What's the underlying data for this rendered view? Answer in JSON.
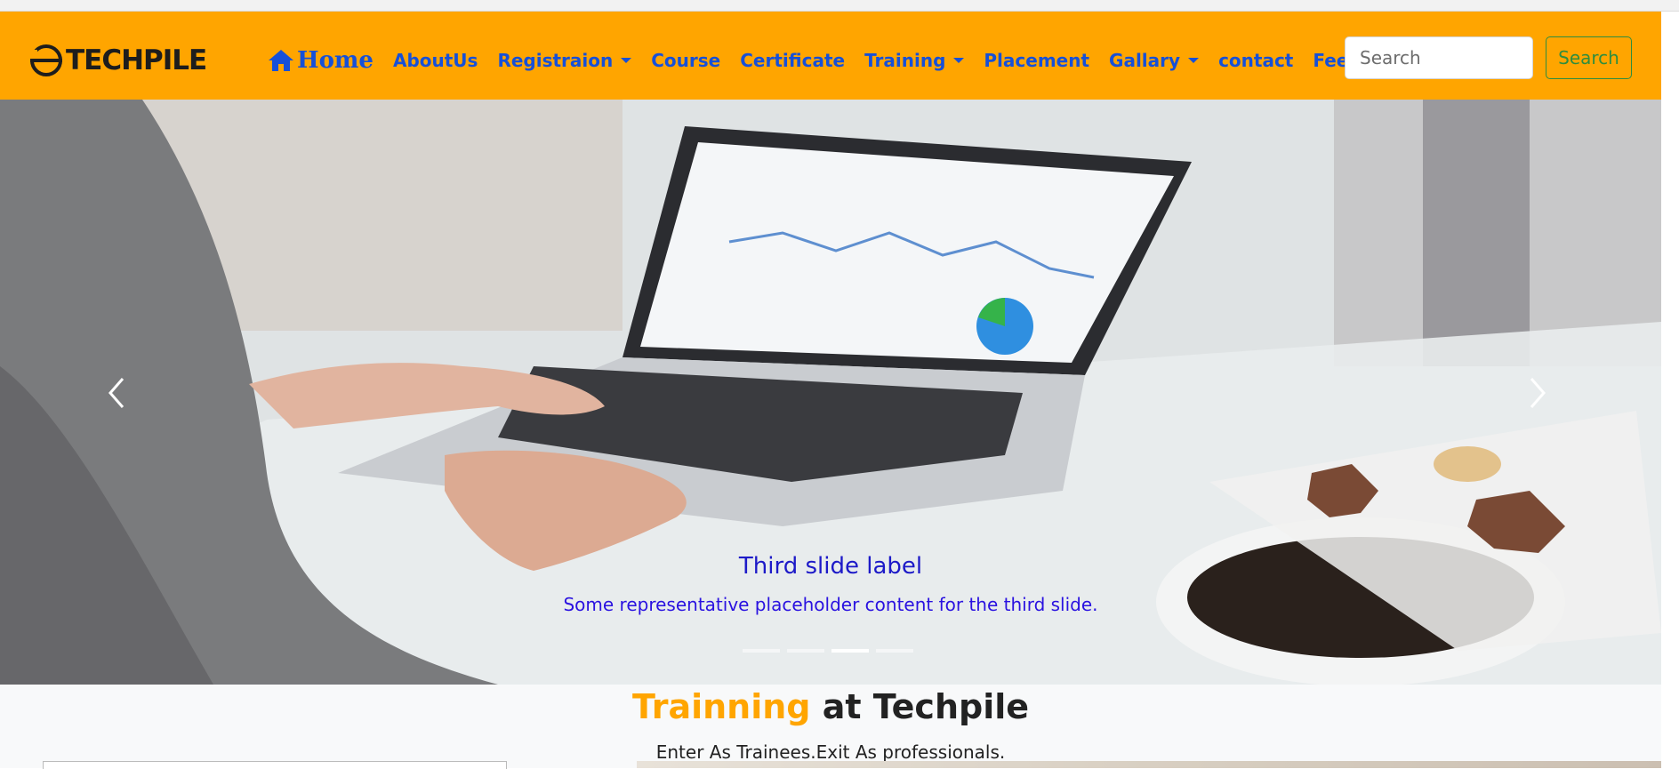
{
  "brand": {
    "name": "TECHPILE"
  },
  "nav": {
    "items": [
      {
        "label": "Home"
      },
      {
        "label": "AboutUs"
      },
      {
        "label": "Registraion"
      },
      {
        "label": "Course"
      },
      {
        "label": "Certificate"
      },
      {
        "label": "Training"
      },
      {
        "label": "Placement"
      },
      {
        "label": "Gallary"
      },
      {
        "label": "contact"
      },
      {
        "label": "Feedback"
      }
    ],
    "search_placeholder": "Search",
    "search_button": "Search"
  },
  "carousel": {
    "active_index": 2,
    "indicator_count": 4,
    "caption_title": "Third slide label",
    "caption_text": "Some representative placeholder content for the third slide."
  },
  "section": {
    "title_highlight": "Trainning",
    "title_rest": "at Techpile",
    "subtitle": "Enter As Trainees.Exit As professionals."
  },
  "colors": {
    "navbar": "#ffa500",
    "nav_link": "#1650d8",
    "search_button": "#2f8d3e",
    "caption": "#1d1ac8"
  },
  "icons": {
    "home": "home-icon",
    "prev": "chevron-left-icon",
    "next": "chevron-right-icon",
    "dropdown": "caret-down-icon"
  }
}
